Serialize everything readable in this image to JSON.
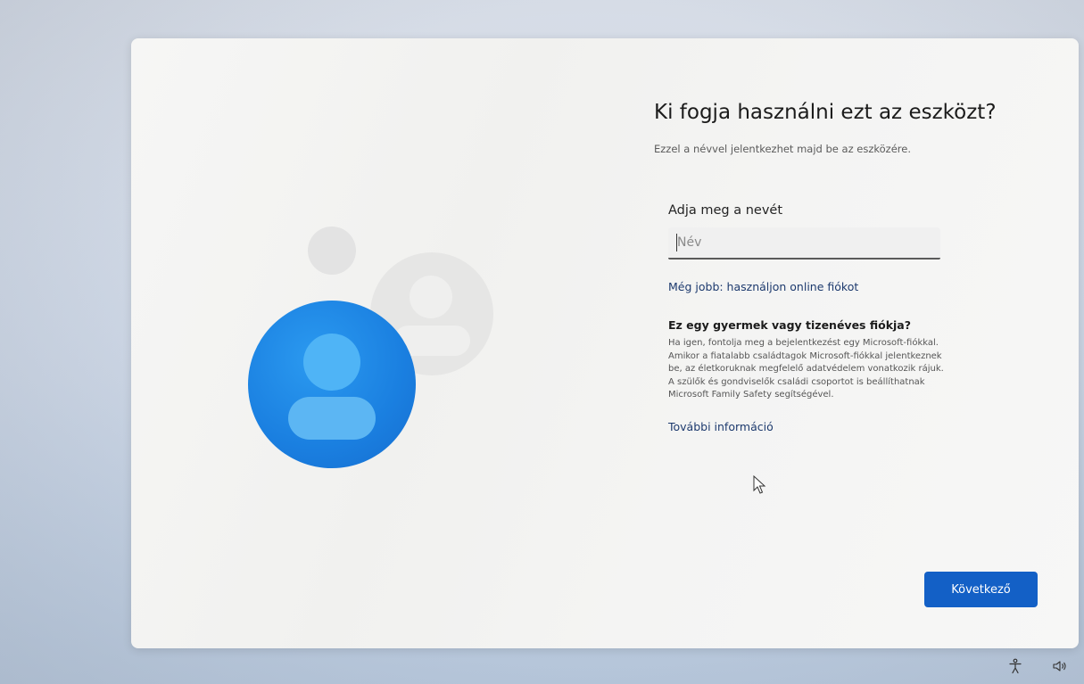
{
  "oobe": {
    "title": "Ki fogja használni ezt az eszközt?",
    "subtitle": "Ezzel a névvel jelentkezhet majd be az eszközére.",
    "name_field": {
      "label": "Adja meg a nevét",
      "placeholder": "Név",
      "value": ""
    },
    "online_account_link": "Még jobb: használjon online fiókot",
    "child_account": {
      "heading": "Ez egy gyermek vagy tizenéves fiókja?",
      "body": "Ha igen, fontolja meg a bejelentkezést egy Microsoft-fiókkal. Amikor a fiatalabb családtagok Microsoft-fiókkal jelentkeznek be, az életkoruknak megfelelő adatvédelem vonatkozik rájuk. A szülők és gondviselők családi csoportot is beállíthatnak Microsoft Family Safety segítségével."
    },
    "more_info_link": "További információ",
    "next_button": "Következő"
  },
  "icons": {
    "avatar": "user-avatar-icon",
    "accessibility": "accessibility-icon",
    "volume": "volume-icon",
    "cursor": "mouse-pointer-icon"
  },
  "colors": {
    "accent": "#1360c6",
    "avatar_blue": "#1a7fe0",
    "link": "#1d3a6e"
  }
}
